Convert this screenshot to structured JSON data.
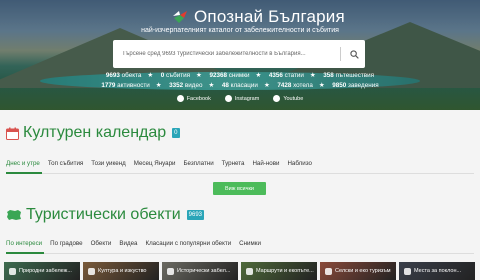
{
  "header": {
    "title": "Опознай България",
    "tagline": "най-изчерпателният каталог от забележителности и събития",
    "search_placeholder": "Търсене сред 9693 туристически забележителности в България..."
  },
  "stats": {
    "row1": [
      {
        "value": "9693",
        "label": "обекта"
      },
      {
        "value": "0",
        "label": "събития"
      },
      {
        "value": "92368",
        "label": "снимки"
      },
      {
        "value": "4356",
        "label": "статии"
      },
      {
        "value": "358",
        "label": "пътешествия"
      }
    ],
    "row2": [
      {
        "value": "1779",
        "label": "активности"
      },
      {
        "value": "3352",
        "label": "видео"
      },
      {
        "value": "48",
        "label": "класации"
      },
      {
        "value": "7428",
        "label": "хотела"
      },
      {
        "value": "9850",
        "label": "заведения"
      }
    ]
  },
  "social": [
    "Facebook",
    "Instagram",
    "Youtube"
  ],
  "calendar": {
    "title": "Културен календар",
    "count": "0",
    "tabs": [
      "Днес и утре",
      "Топ събития",
      "Този уикенд",
      "Месец Януари",
      "Безплатни",
      "Турнета",
      "Най-нови",
      "Наблизо"
    ],
    "show_all": "Виж всички"
  },
  "objects": {
    "title": "Туристически обекти",
    "count": "9693",
    "tabs": [
      "По интереси",
      "По градове",
      "Обекти",
      "Видеа",
      "Класации с популярни обекти",
      "Снимки"
    ]
  },
  "tiles": [
    {
      "label": "Природни забележ...",
      "color": "#3d6b4f"
    },
    {
      "label": "Култура и изкуство",
      "color": "#7a5a3a"
    },
    {
      "label": "Исторически забел...",
      "color": "#6b6a62"
    },
    {
      "label": "Маршрути и екопъте...",
      "color": "#4f6a3a"
    },
    {
      "label": "Селски и еко туризъм",
      "color": "#8a4a3a"
    },
    {
      "label": "Места за поклон...",
      "color": "#3a3f4a"
    }
  ],
  "colors": {
    "accent": "#2b8a3e",
    "button": "#4cbb5a",
    "badge": "#2aa5b8"
  }
}
